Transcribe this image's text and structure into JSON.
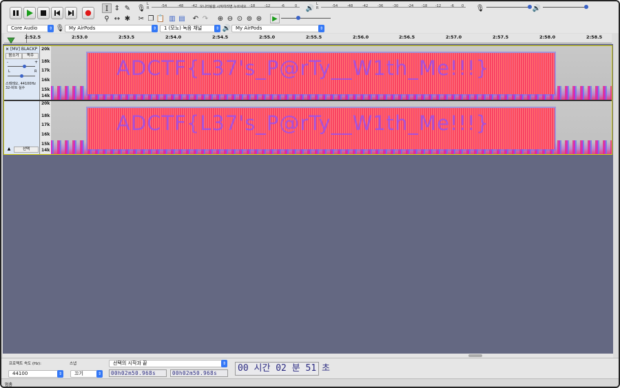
{
  "transport": {
    "pause": "pause",
    "play": "play",
    "stop": "stop",
    "skip_start": "skip-to-start",
    "skip_end": "skip-to-end",
    "record": "record"
  },
  "meters": {
    "record_ticks": [
      "-54",
      "-48",
      "-42",
      "모니터링을 시작하려면 누르세요",
      "-18",
      "-12",
      "-6",
      "0"
    ],
    "play_ticks": [
      "-54",
      "-48",
      "-42",
      "-36",
      "-30",
      "-24",
      "-18",
      "-12",
      "-6",
      "0"
    ],
    "lr_top": "L",
    "lr_bottom": "R"
  },
  "device": {
    "host": "Core Audio",
    "record_device": "My AirPods",
    "channels": "1 (모노) 녹음 채널",
    "play_device": "My AirPods"
  },
  "ruler": {
    "labels": [
      "2:52.5",
      "2:53.0",
      "2:53.5",
      "2:54.0",
      "2:54.5",
      "2:55.0",
      "2:55.5",
      "2:56.0",
      "2:56.5",
      "2:57.0",
      "2:57.5",
      "2:58.0",
      "2:58.5"
    ]
  },
  "track": {
    "name": "[MV] BLACKP",
    "mute": "음소거",
    "solo": "독주",
    "gain_minus": "-",
    "gain_plus": "+",
    "pan_l": "L",
    "pan_r": "R",
    "info": "스테레오, 44100Hz\n32-비트 실수",
    "select": "선택",
    "axis_labels": [
      "20k",
      "18k",
      "17k",
      "16k",
      "15k",
      "14k"
    ],
    "spectrogram_text": "ADCTF{L37's_P@rTy__W1th_Me!!!}"
  },
  "footer": {
    "rate_label": "프로젝트 속도 (Hz):",
    "rate_value": "44100",
    "snap_label": "스냅",
    "snap_value": "끄기",
    "selection_mode": "선택의 시작과 끝",
    "sel_start": "00h02m50.968s",
    "sel_end": "00h02m50.968s",
    "big_time": "00 시간 02 분 51 초",
    "status": "멈춤"
  }
}
